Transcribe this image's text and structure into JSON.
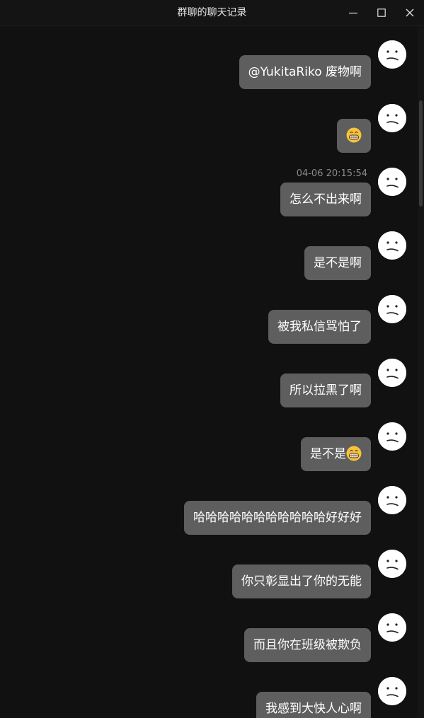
{
  "window": {
    "title": "群聊的聊天记录"
  },
  "icons": {
    "minimize": "minimize-icon",
    "maximize": "maximize-icon",
    "close": "close-icon",
    "avatar": "confused-face-avatar",
    "emoji": "grinning-face-emoji"
  },
  "messages": [
    {
      "text": "@YukitaRiko 废物啊",
      "emoji": false,
      "timestamp": ""
    },
    {
      "text": "",
      "emoji": true,
      "timestamp": ""
    },
    {
      "text": "怎么不出来啊",
      "emoji": false,
      "timestamp": "04-06 20:15:54"
    },
    {
      "text": "是不是啊",
      "emoji": false,
      "timestamp": ""
    },
    {
      "text": "被我私信骂怕了",
      "emoji": false,
      "timestamp": ""
    },
    {
      "text": "所以拉黑了啊",
      "emoji": false,
      "timestamp": ""
    },
    {
      "text": "是不是",
      "emoji": true,
      "timestamp": ""
    },
    {
      "text": "哈哈哈哈哈哈哈哈哈哈哈好好好",
      "emoji": false,
      "timestamp": ""
    },
    {
      "text": "你只彰显出了你的无能",
      "emoji": false,
      "timestamp": ""
    },
    {
      "text": "而且你在班级被欺负",
      "emoji": false,
      "timestamp": ""
    },
    {
      "text": "我感到大快人心啊",
      "emoji": false,
      "timestamp": ""
    }
  ],
  "colors": {
    "background": "#111111",
    "bubble": "#5e5e5e",
    "bubble_text": "#ffffff",
    "timestamp": "#8a8a8a",
    "emoji_face": "#f6c33b"
  }
}
